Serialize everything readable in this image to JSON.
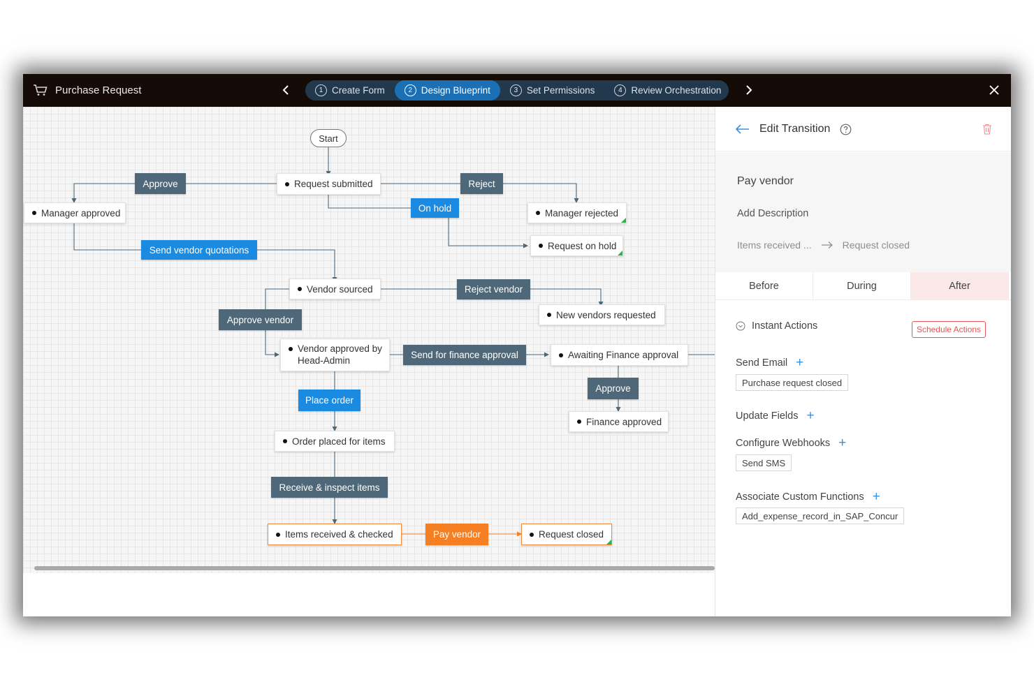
{
  "header": {
    "app_title": "Purchase Request",
    "steps": [
      {
        "num": "1",
        "label": "Create Form",
        "active": false
      },
      {
        "num": "2",
        "label": "Design Blueprint",
        "active": true
      },
      {
        "num": "3",
        "label": "Set Permissions",
        "active": false
      },
      {
        "num": "4",
        "label": "Review Orchestration",
        "active": false
      }
    ]
  },
  "blueprint": {
    "start_label": "Start",
    "states": {
      "request_submitted": "Request submitted",
      "manager_approved": "Manager approved",
      "manager_rejected": "Manager rejected",
      "request_on_hold": "Request on hold",
      "vendor_sourced": "Vendor sourced",
      "new_vendors_requested": "New vendors requested",
      "vendor_approved": "Vendor approved by Head-Admin",
      "awaiting_finance": "Awaiting Finance approval",
      "finance_approved": "Finance approved",
      "order_placed": "Order placed for items",
      "items_received": "Items received & checked",
      "request_closed": "Request closed"
    },
    "transitions": {
      "approve": "Approve",
      "reject": "Reject",
      "on_hold": "On hold",
      "send_vendor_quotations": "Send vendor quotations",
      "reject_vendor": "Reject vendor",
      "approve_vendor": "Approve vendor",
      "send_for_finance_approval": "Send for finance approval",
      "approve_finance": "Approve",
      "place_order": "Place order",
      "receive_inspect": "Receive & inspect items",
      "pay_vendor": "Pay vendor"
    }
  },
  "panel": {
    "title": "Edit Transition",
    "transition_name": "Pay vendor",
    "add_description": "Add Description",
    "from_state": "Items received ...",
    "to_state": "Request closed",
    "tabs": [
      "Before",
      "During",
      "After"
    ],
    "active_tab": "After",
    "instant_actions": "Instant Actions",
    "schedule_actions": "Schedule Actions",
    "send_email": {
      "label": "Send Email",
      "chip": "Purchase request closed"
    },
    "update_fields": {
      "label": "Update Fields"
    },
    "configure_webhooks": {
      "label": "Configure Webhooks",
      "chip": "Send SMS"
    },
    "custom_functions": {
      "label": "Associate Custom Functions",
      "chip": "Add_expense_record_in_SAP_Concur"
    }
  },
  "colors": {
    "topbar": "#140b07",
    "step_track": "#22384c",
    "step_active": "#1b6fb4",
    "transition_dark": "#4e6879",
    "transition_blue": "#1a8be0",
    "transition_orange": "#f57f22",
    "end_marker": "#2bb24c",
    "schedule_red": "#e45454",
    "active_tab_bg": "#fbe8e8"
  },
  "icons": [
    "cart-icon",
    "chevron-left-icon",
    "chevron-right-icon",
    "close-icon",
    "back-arrow-icon",
    "help-icon",
    "trash-icon",
    "arrow-right-icon",
    "chevron-down-circle-icon",
    "plus-icon"
  ]
}
